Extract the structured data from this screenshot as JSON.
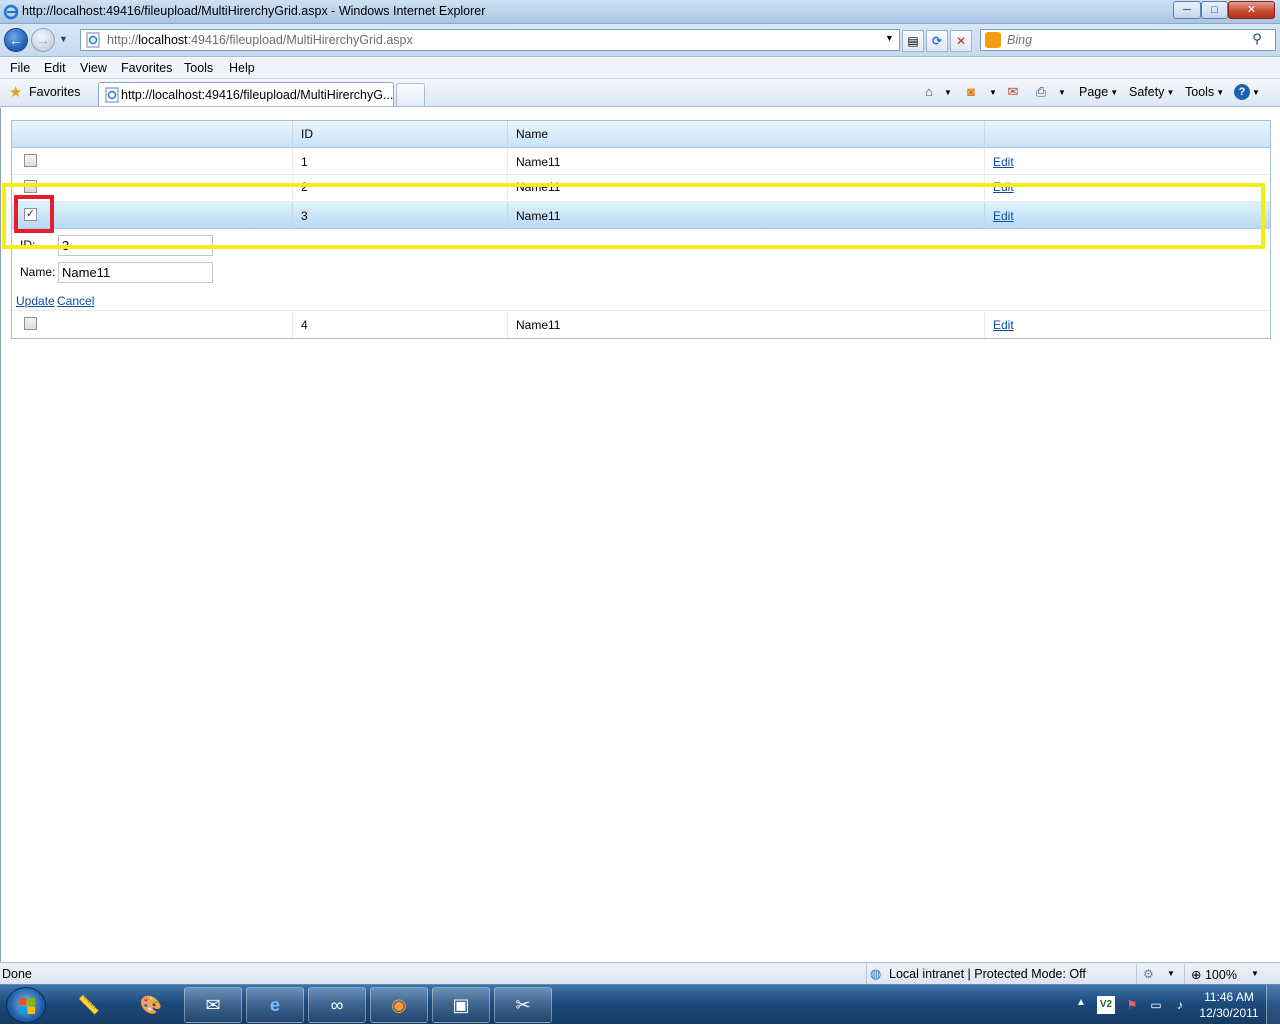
{
  "window": {
    "title": "http://localhost:49416/fileupload/MultiHirerchyGrid.aspx - Windows Internet Explorer",
    "minimize_glyph": "─",
    "maximize_glyph": "□",
    "close_glyph": "✕"
  },
  "address_bar": {
    "url_prefix": "http://",
    "url_host": "localhost",
    "url_rest": ":49416/fileupload/MultiHirerchyGrid.aspx"
  },
  "search": {
    "placeholder": "Bing"
  },
  "menu": [
    "File",
    "Edit",
    "View",
    "Favorites",
    "Tools",
    "Help"
  ],
  "favorites_bar": {
    "favorites_label": "Favorites",
    "tab_title": "http://localhost:49416/fileupload/MultiHirerchyG...",
    "commands": [
      "Page",
      "Safety",
      "Tools"
    ]
  },
  "grid": {
    "headers": [
      "",
      "ID",
      "Name",
      ""
    ],
    "rows": [
      {
        "checked": false,
        "id": "1",
        "name": "Name11",
        "action": "Edit",
        "selected": false
      },
      {
        "checked": false,
        "id": "2",
        "name": "Name11",
        "action": "Edit",
        "selected": false
      },
      {
        "checked": true,
        "id": "3",
        "name": "Name11",
        "action": "Edit",
        "selected": true
      }
    ],
    "edit_form": {
      "id_label": "ID:",
      "id_value": "3",
      "name_label": "Name:",
      "name_value": "Name11",
      "update_label": "Update",
      "cancel_label": "Cancel"
    },
    "last_row": {
      "checked": false,
      "id": "4",
      "name": "Name11",
      "action": "Edit"
    },
    "check_glyph": "✓"
  },
  "annotations": {
    "highlight_color": "#f2ee16",
    "checkbox_highlight_color": "#e21f2a"
  },
  "status_bar": {
    "status": "Done",
    "zone": "Local intranet | Protected Mode: Off",
    "zoom": "100%"
  },
  "taskbar": {
    "time": "11:46 AM",
    "date": "12/30/2011"
  },
  "icons": {
    "back": "back-arrow-icon",
    "forward": "forward-arrow-icon",
    "refresh": "refresh-icon",
    "stop": "stop-icon",
    "search": "magnifier-icon",
    "home": "home-icon",
    "feeds": "rss-feed-icon",
    "mail": "mail-icon",
    "print": "printer-icon",
    "help": "help-icon"
  }
}
